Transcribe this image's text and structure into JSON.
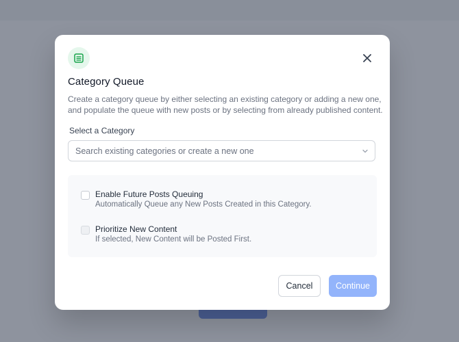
{
  "modal": {
    "icon": "list-icon",
    "title": "Category Queue",
    "description": "Create a category queue by either selecting an existing category or adding a new one, and populate the queue with new posts or by selecting from already published content.",
    "close_icon": "close-icon"
  },
  "category": {
    "label": "Select a Category",
    "placeholder": "Search existing categories or create a new one",
    "chevron_icon": "chevron-down-icon"
  },
  "options": [
    {
      "title": "Enable Future Posts Queuing",
      "subtitle": "Automatically Queue any New Posts Created in this Category.",
      "checked": false,
      "disabled": false
    },
    {
      "title": "Prioritize New Content",
      "subtitle": "If selected, New Content will be Posted First.",
      "checked": false,
      "disabled": true
    }
  ],
  "footer": {
    "cancel_label": "Cancel",
    "continue_label": "Continue"
  },
  "colors": {
    "accent": "#93b4fb",
    "icon_bg": "#e5f7ec",
    "icon_fg": "#16a34a",
    "overlay": "#8a909c"
  }
}
